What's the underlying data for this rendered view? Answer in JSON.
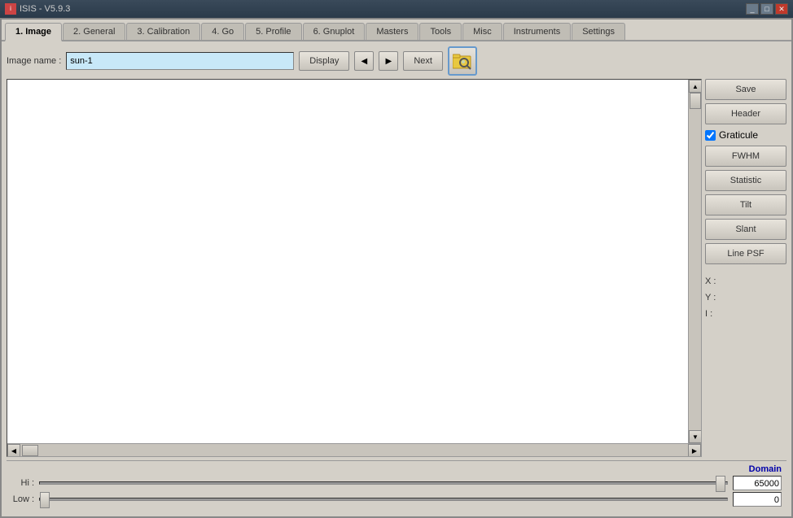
{
  "window": {
    "title": "ISIS - V5.9.3",
    "controls": [
      "minimize",
      "maximize",
      "close"
    ]
  },
  "tabs": [
    {
      "id": "image",
      "label": "1. Image",
      "active": true
    },
    {
      "id": "general",
      "label": "2. General",
      "active": false
    },
    {
      "id": "calibration",
      "label": "3. Calibration",
      "active": false
    },
    {
      "id": "go",
      "label": "4. Go",
      "active": false
    },
    {
      "id": "profile",
      "label": "5. Profile",
      "active": false
    },
    {
      "id": "gnuplot",
      "label": "6. Gnuplot",
      "active": false
    },
    {
      "id": "masters",
      "label": "Masters",
      "active": false
    },
    {
      "id": "tools",
      "label": "Tools",
      "active": false
    },
    {
      "id": "misc",
      "label": "Misc",
      "active": false
    },
    {
      "id": "instruments",
      "label": "Instruments",
      "active": false
    },
    {
      "id": "settings",
      "label": "Settings",
      "active": false
    }
  ],
  "toolbar": {
    "image_name_label": "Image name :",
    "image_name_value": "sun-1",
    "display_button": "Display",
    "next_button": "Next"
  },
  "right_panel": {
    "save_button": "Save",
    "header_button": "Header",
    "graticule_label": "Graticule",
    "graticule_checked": true,
    "fwhm_button": "FWHM",
    "statistic_button": "Statistic",
    "tilt_button": "Tilt",
    "slant_button": "Slant",
    "line_psf_button": "Line PSF",
    "coord_x_label": "X :",
    "coord_y_label": "Y :",
    "coord_i_label": "I :"
  },
  "bottom": {
    "domain_label": "Domain",
    "hi_label": "Hi :",
    "hi_value": "65000",
    "low_label": "Low :",
    "low_value": "0"
  },
  "nav": {
    "prev_arrow": "◀",
    "next_arrow": "▶"
  }
}
